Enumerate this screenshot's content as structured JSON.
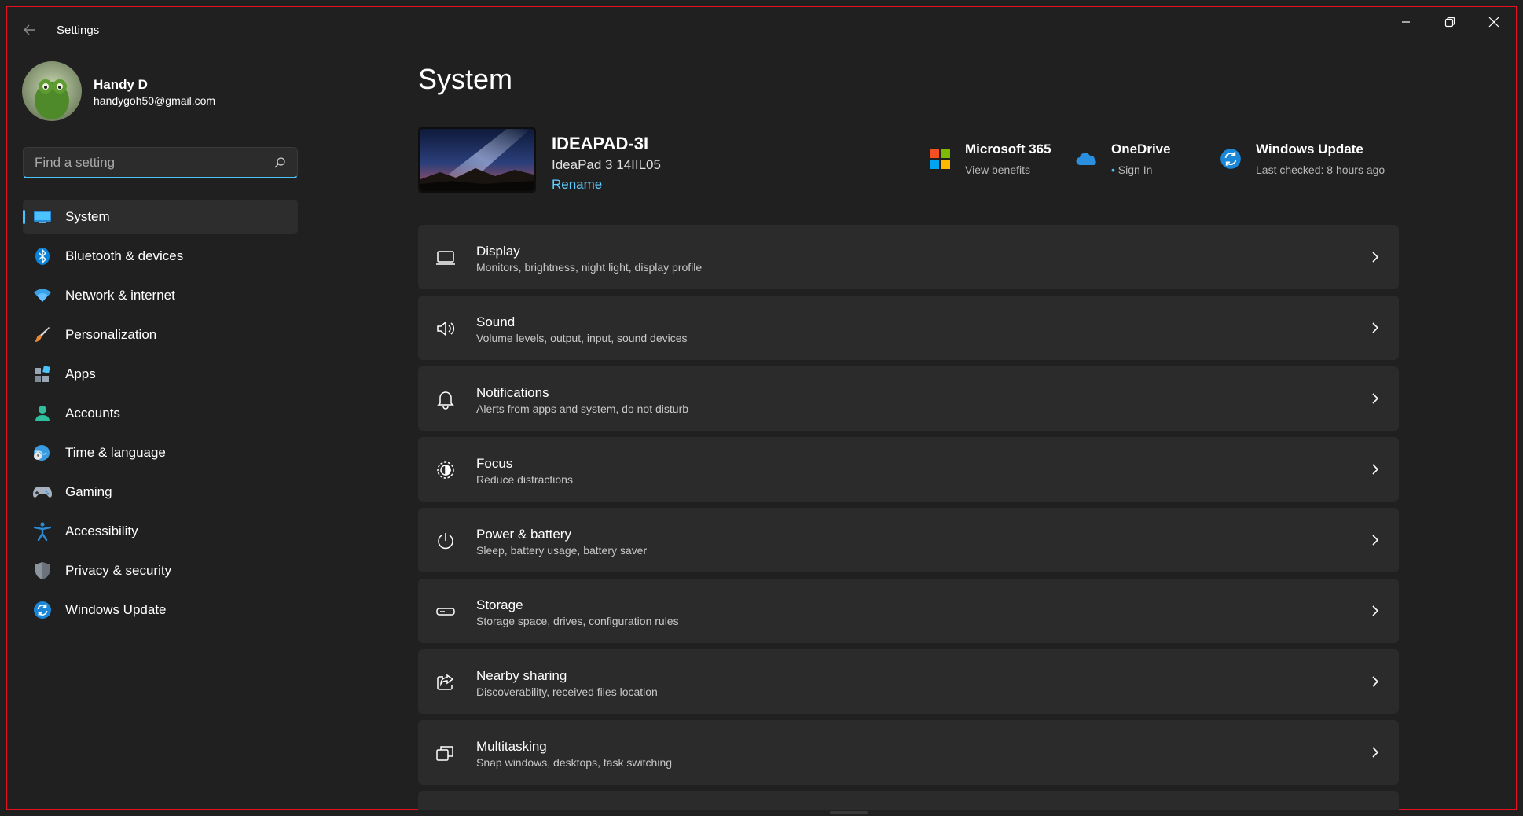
{
  "window": {
    "title": "Settings",
    "back_icon": "back-arrow-icon",
    "minimize_icon": "minimize-icon",
    "restore_icon": "restore-icon",
    "close_icon": "close-icon"
  },
  "user": {
    "name": "Handy D",
    "email": "handygoh50@gmail.com"
  },
  "search": {
    "placeholder": "Find a setting",
    "value": ""
  },
  "sidebar": {
    "items": [
      {
        "label": "System",
        "icon": "system-icon",
        "active": true
      },
      {
        "label": "Bluetooth & devices",
        "icon": "bluetooth-icon"
      },
      {
        "label": "Network & internet",
        "icon": "wifi-icon"
      },
      {
        "label": "Personalization",
        "icon": "brush-icon"
      },
      {
        "label": "Apps",
        "icon": "apps-icon"
      },
      {
        "label": "Accounts",
        "icon": "accounts-icon"
      },
      {
        "label": "Time & language",
        "icon": "globe-clock-icon"
      },
      {
        "label": "Gaming",
        "icon": "gamepad-icon"
      },
      {
        "label": "Accessibility",
        "icon": "accessibility-icon"
      },
      {
        "label": "Privacy & security",
        "icon": "shield-icon"
      },
      {
        "label": "Windows Update",
        "icon": "update-icon"
      }
    ]
  },
  "main": {
    "title": "System",
    "device": {
      "name": "IDEAPAD-3I",
      "model": "IdeaPad 3 14IIL05",
      "rename_label": "Rename"
    },
    "quick_links": [
      {
        "title": "Microsoft 365",
        "subtitle": "View benefits",
        "icon": "microsoft-365-icon"
      },
      {
        "title": "OneDrive",
        "subtitle": "Sign In",
        "icon": "onedrive-cloud-icon"
      },
      {
        "title": "Windows Update",
        "subtitle": "Last checked: 8 hours ago",
        "icon": "windows-update-icon"
      }
    ],
    "cards": [
      {
        "title": "Display",
        "subtitle": "Monitors, brightness, night light, display profile",
        "icon": "display-icon"
      },
      {
        "title": "Sound",
        "subtitle": "Volume levels, output, input, sound devices",
        "icon": "speaker-icon"
      },
      {
        "title": "Notifications",
        "subtitle": "Alerts from apps and system, do not disturb",
        "icon": "bell-icon"
      },
      {
        "title": "Focus",
        "subtitle": "Reduce distractions",
        "icon": "focus-icon"
      },
      {
        "title": "Power & battery",
        "subtitle": "Sleep, battery usage, battery saver",
        "icon": "power-icon"
      },
      {
        "title": "Storage",
        "subtitle": "Storage space, drives, configuration rules",
        "icon": "storage-icon"
      },
      {
        "title": "Nearby sharing",
        "subtitle": "Discoverability, received files location",
        "icon": "share-icon"
      },
      {
        "title": "Multitasking",
        "subtitle": "Snap windows, desktops, task switching",
        "icon": "multitasking-icon"
      }
    ]
  },
  "colors": {
    "background": "#202020",
    "card": "#2b2b2b",
    "accent": "#4cc2ff",
    "link": "#60cdff",
    "frame_border": "#e81123"
  }
}
